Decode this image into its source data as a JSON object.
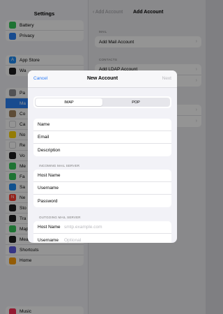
{
  "background": {
    "sidebar": {
      "title": "Settings",
      "groups": [
        [
          {
            "label": "Battery",
            "icon": "battery-icon",
            "color": "#34c759",
            "glyph": ""
          },
          {
            "label": "Privacy",
            "icon": "hand-icon",
            "color": "#2a82f6",
            "glyph": ""
          }
        ],
        [
          {
            "label": "App Store",
            "icon": "appstore-icon",
            "color": "#1e8cf5",
            "glyph": "A"
          },
          {
            "label": "Wa",
            "icon": "wallet-icon",
            "color": "#1c1c1e",
            "glyph": ""
          }
        ],
        [
          {
            "label": "Pa",
            "icon": "passwords-icon",
            "color": "#8e8e93",
            "glyph": ""
          },
          {
            "label": "Ma",
            "icon": "mail-icon",
            "color": "#2a82f6",
            "glyph": "",
            "selected": true
          },
          {
            "label": "Co",
            "icon": "contacts-icon",
            "color": "#a2845e",
            "glyph": ""
          },
          {
            "label": "Ca",
            "icon": "calendar-icon",
            "color": "#ffffff",
            "glyph": ""
          },
          {
            "label": "No",
            "icon": "notes-icon",
            "color": "#ffd60a",
            "glyph": ""
          },
          {
            "label": "Re",
            "icon": "reminders-icon",
            "color": "#ffffff",
            "glyph": ""
          },
          {
            "label": "Vo",
            "icon": "voicememos-icon",
            "color": "#1c1c1e",
            "glyph": ""
          },
          {
            "label": "Me",
            "icon": "messages-icon",
            "color": "#34c759",
            "glyph": ""
          },
          {
            "label": "Fa",
            "icon": "facetime-icon",
            "color": "#34c759",
            "glyph": ""
          },
          {
            "label": "Sa",
            "icon": "safari-icon",
            "color": "#1e8cf5",
            "glyph": ""
          },
          {
            "label": "Ne",
            "icon": "news-icon",
            "color": "#ff3b30",
            "glyph": "N"
          },
          {
            "label": "Sto",
            "icon": "stocks-icon",
            "color": "#1c1c1e",
            "glyph": ""
          },
          {
            "label": "Tra",
            "icon": "translate-icon",
            "color": "#1c1c1e",
            "glyph": ""
          },
          {
            "label": "Maps",
            "icon": "maps-icon",
            "color": "#34c759",
            "glyph": ""
          },
          {
            "label": "Measure",
            "icon": "measure-icon",
            "color": "#1c1c1e",
            "glyph": ""
          },
          {
            "label": "Shortcuts",
            "icon": "shortcuts-icon",
            "color": "#5e5ce6",
            "glyph": ""
          },
          {
            "label": "Home",
            "icon": "home-icon",
            "color": "#ff9f0a",
            "glyph": ""
          }
        ],
        [
          {
            "label": "Music",
            "icon": "music-icon",
            "color": "#ff2d55",
            "glyph": ""
          }
        ]
      ]
    },
    "detail": {
      "back_label": "Add Account",
      "title": "Add Account",
      "mail_section": "MAIL",
      "mail_rows": [
        "Add Mail Account"
      ],
      "contacts_section": "CONTACTS",
      "contacts_rows": [
        "Add LDAP Account",
        ""
      ],
      "other_rows": [
        "",
        ""
      ]
    }
  },
  "sheet": {
    "cancel_label": "Cancel",
    "title": "New Account",
    "next_label": "Next",
    "segments": [
      "IMAP",
      "POP"
    ],
    "selected_segment": "IMAP",
    "account_fields": [
      "Name",
      "Email",
      "Description"
    ],
    "incoming_label": "INCOMING MAIL SERVER",
    "incoming_fields": [
      "Host Name",
      "Username",
      "Password"
    ],
    "outgoing_label": "OUTGOING MAIL SERVER",
    "outgoing_fields": [
      {
        "label": "Host Name",
        "placeholder": "smtp.example.com"
      },
      {
        "label": "Username",
        "placeholder": "Optional"
      }
    ]
  }
}
